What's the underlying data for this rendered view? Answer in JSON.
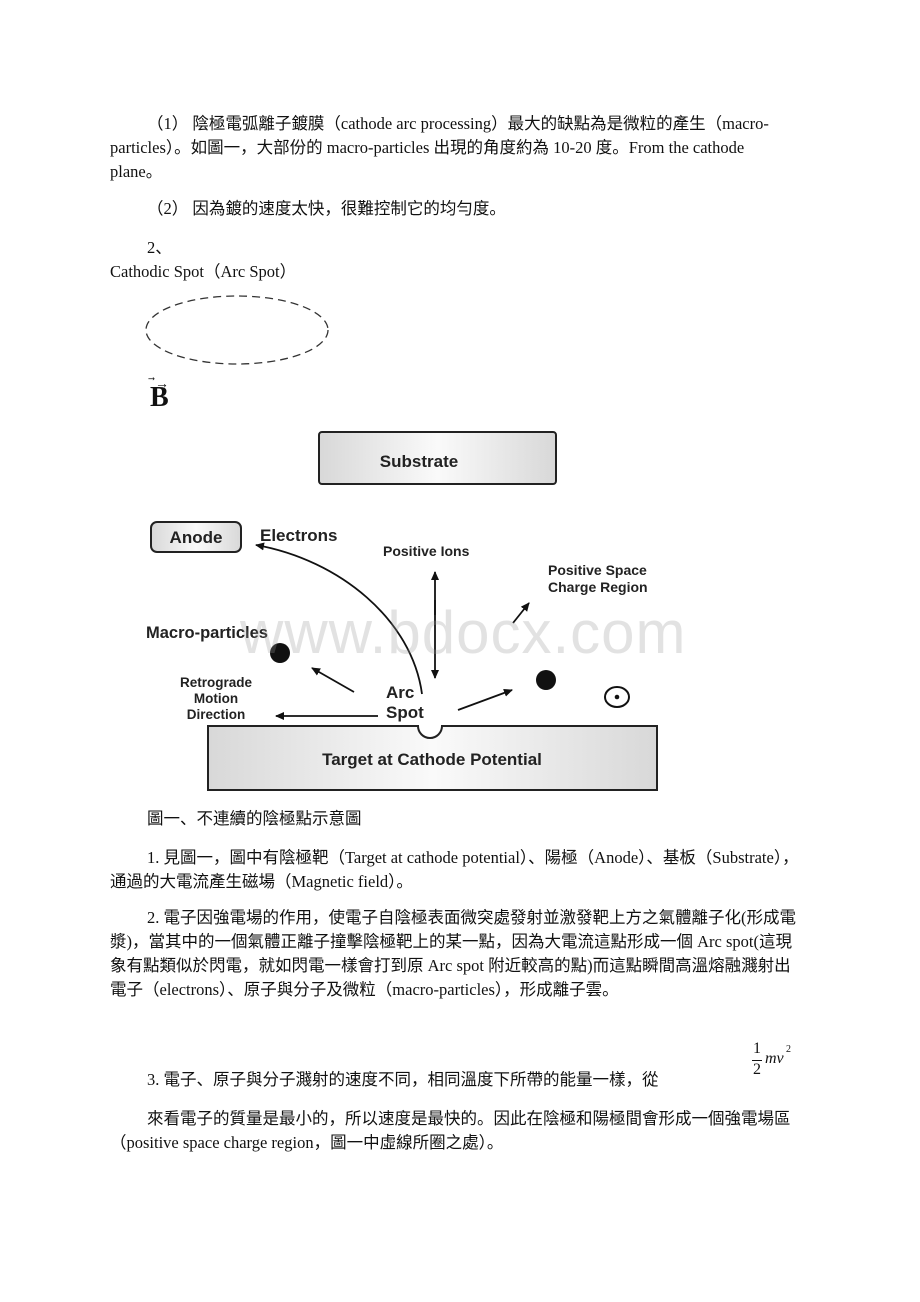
{
  "document": {
    "paragraphs": {
      "p1": "（1） 陰極電弧離子鍍膜（cathode arc processing）最大的缺點為是微粒的產生（macro-particles）。如圖一，大部份的 macro-particles 出現的角度約為 10-20 度。From the cathode plane。",
      "p2": "（2） 因為鍍的速度太快，很難控制它的均勻度。",
      "section2_number": "2、",
      "section2_title": "Cathodic Spot（Arc Spot）",
      "caption": "圖一、不連續的陰極點示意圖",
      "item1": "1. 見圖一，圖中有陰極靶（Target at cathode potential）、陽極（Anode）、基板（Substrate），通過的大電流產生磁場（Magnetic field）。",
      "item2": "2. 電子因強電場的作用，使電子自陰極表面微突處發射並激發靶上方之氣體離子化(形成電漿)，當其中的一個氣體正離子撞擊陰極靶上的某一點，因為大電流這點形成一個 Arc spot(這現象有點類似於閃電，就如閃電一樣會打到原 Arc spot 附近較高的點)而這點瞬間高溫熔融濺射出電子（electrons）、原子與分子及微粒（macro-particles），形成離子雲。",
      "item3": "3. 電子、原子與分子濺射的速度不同，相同溫度下所帶的能量一樣，從",
      "item3_cont": "來看電子的質量是最小的，所以速度是最快的。因此在陰極和陽極間會形成一個強電場區（positive space charge region，圖一中虛線所圈之處）。"
    },
    "formula": {
      "numerator": "1",
      "denominator": "2",
      "rest": "mv",
      "exponent": "2"
    },
    "vector_label": "B",
    "watermark": "www.bdocx.com"
  },
  "diagram": {
    "substrate": "Substrate",
    "anode": "Anode",
    "electrons": "Electrons",
    "positive_ions": "Positive Ions",
    "space_charge_line1": "Positive Space",
    "space_charge_line2": "Charge Region",
    "macro_particles": "Macro-particles",
    "retrograde_line1": "Retrograde",
    "retrograde_line2": "Motion",
    "retrograde_line3": "Direction",
    "arc_line1": "Arc",
    "arc_line2": "Spot",
    "target": "Target at Cathode Potential"
  }
}
